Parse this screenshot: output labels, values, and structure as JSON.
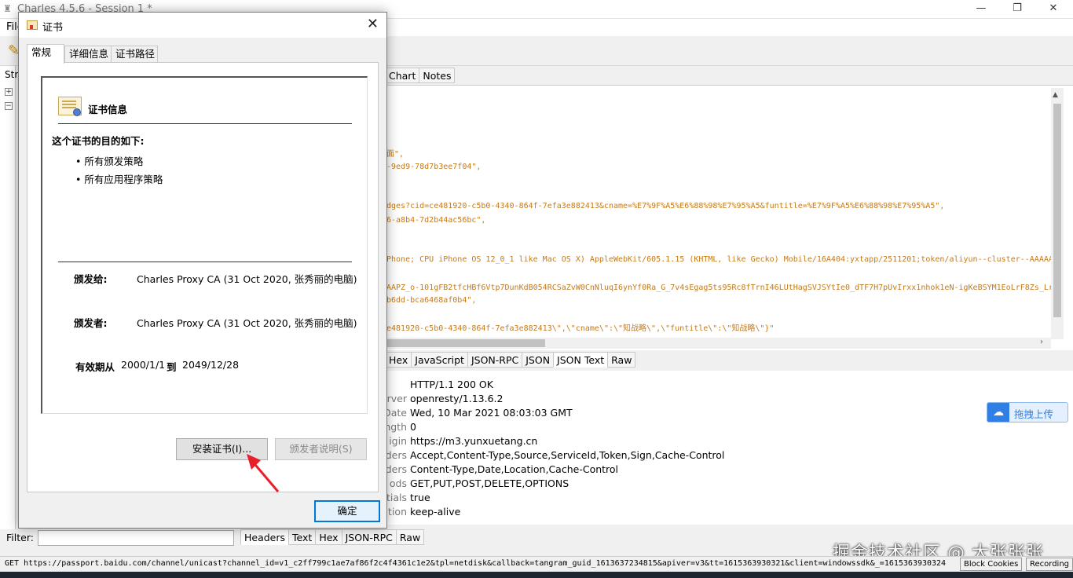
{
  "window": {
    "title": "Charles 4.5.6 - Session 1 *",
    "menu_first": "File",
    "minimize": "—",
    "maximize": "❐",
    "close": "✕"
  },
  "left_pane": {
    "tab": "Str"
  },
  "response_tabs": [
    "Chart",
    "Notes"
  ],
  "code_lines": [
    "面\",",
    "-9ed9-78d7b3ee7f04\",",
    "dges?cid=ce481920-c5b0-4340-864f-7efa3e882413&cname=%E7%9F%A5%E6%88%98%E7%95%A5&funtitle=%E7%9F%A5%E6%88%98%E7%95%A5\",",
    "6-a8b4-7d2b44ac56bc\",",
    "Phone; CPU iPhone OS 12_0_1 like Mac OS X) AppleWebKit/605.1.15 (KHTML, like Gecko) Mobile/16A404:yxtapp/2511201;token/aliyun--cluster--AAAAA",
    "AAPZ_o-101gFB2tfcHBf6Vtp7DunKdB054RCSaZvW0CnNluqI6ynYf0Ra_G_7v4sEgag5ts95Rc8fTrnI46LUtHagSVJSYtIe0_dTF7H7pUvIrxx1nhok1eN-igKeBSYM1EoLrF8Zs_Lr",
    "b6dd-bca6468af0b4\",",
    "e481920-c5b0-4340-864f-7efa3e882413\\\",\\\"cname\\\":\\\"知战略\\\",\\\"funtitle\\\":\\\"知战略\\\"}\""
  ],
  "body_tabs": [
    "Hex",
    "JavaScript",
    "JSON-RPC",
    "JSON",
    "JSON Text",
    "Raw"
  ],
  "body_tabs_active": "JSON Text",
  "headers": [
    {
      "k": "",
      "v": "HTTP/1.1 200 OK"
    },
    {
      "k": "rver",
      "v": "openresty/1.13.6.2"
    },
    {
      "k": "Date",
      "v": "Wed, 10 Mar 2021 08:03:03 GMT"
    },
    {
      "k": "ngth",
      "v": "0"
    },
    {
      "k": "igin",
      "v": "https://m3.yunxuetang.cn"
    },
    {
      "k": "ders",
      "v": "Accept,Content-Type,Source,ServiceId,Token,Sign,Cache-Control"
    },
    {
      "k": "ders",
      "v": "Content-Type,Date,Location,Cache-Control"
    },
    {
      "k": "ods",
      "v": "GET,PUT,POST,DELETE,OPTIONS"
    },
    {
      "k": "tials",
      "v": "true"
    },
    {
      "k": "tion",
      "v": "keep-alive"
    }
  ],
  "bottom_tabs": [
    "Headers",
    "Text",
    "Hex",
    "JSON-RPC",
    "Raw"
  ],
  "bottom_tabs_active": "Headers",
  "filter_label": "Filter:",
  "status": {
    "text": "GET https://passport.baidu.com/channel/unicast?channel_id=v1_c2ff799c1ae7af86f2c4f4361c1e2&tpl=netdisk&callback=tangram_guid_1613637234815&apiver=v3&tt=1615363930321&client=windowssdk&_=1615363930324",
    "block_cookies": "Block Cookies",
    "recording": "Recording"
  },
  "upload_button": "拖拽上传",
  "watermark": "掘金技术社区 @ 大张张张",
  "dialog": {
    "title": "证书",
    "close": "✕",
    "tabs": [
      "常规",
      "详细信息",
      "证书路径"
    ],
    "heading": "证书信息",
    "purpose_title": "这个证书的目的如下:",
    "purposes": [
      "• 所有颁发策略",
      "• 所有应用程序策略"
    ],
    "issued_to_label": "颁发给:",
    "issued_to": "Charles Proxy CA (31 Oct 2020, 张秀丽的电脑)",
    "issued_by_label": "颁发者:",
    "issued_by": "Charles Proxy CA (31 Oct 2020, 张秀丽的电脑)",
    "valid_from_label": "有效期从",
    "valid_from": "2000/1/1",
    "valid_to_label": "到",
    "valid_to": "2049/12/28",
    "install_button": "安装证书(I)...",
    "issuer_statement_button": "颁发者说明(S)",
    "ok_button": "确定"
  },
  "colors": {
    "accent_blue": "#0078d7",
    "arrow_red": "#e8202a",
    "code_orange": "#c47a1a"
  }
}
